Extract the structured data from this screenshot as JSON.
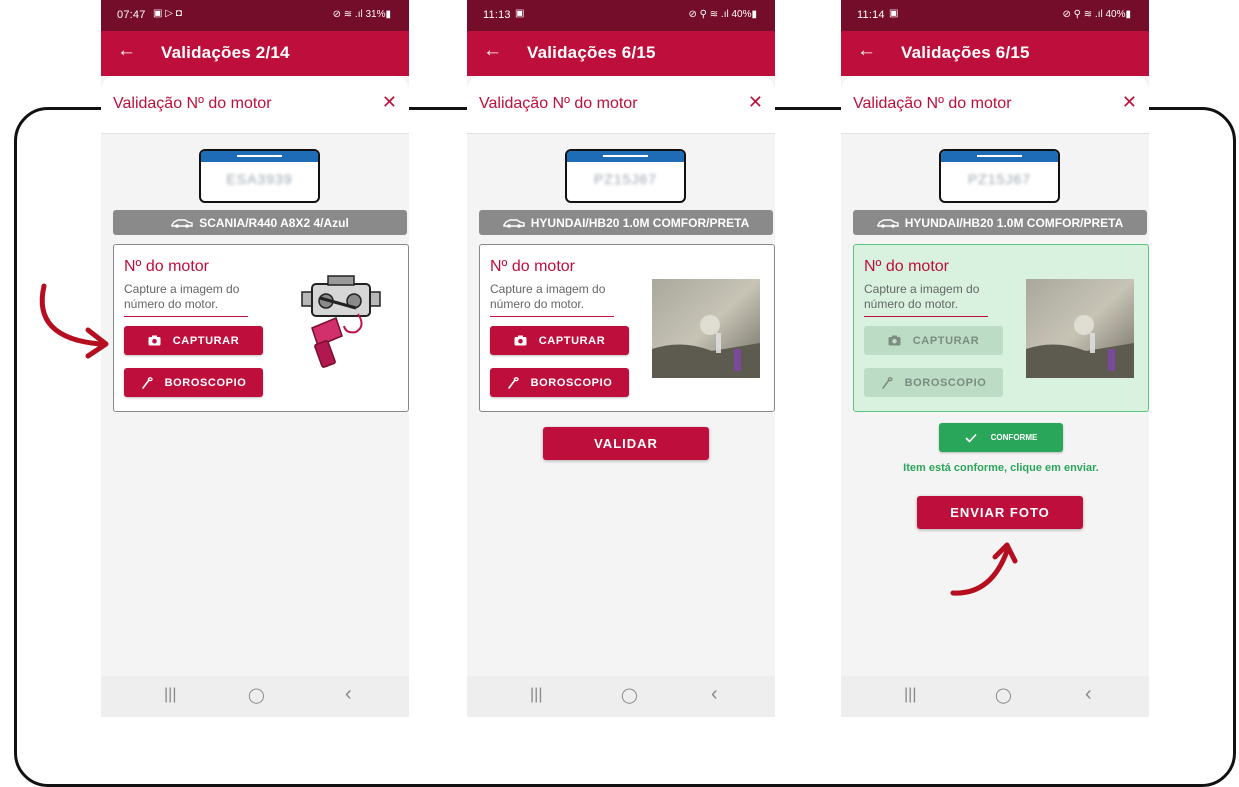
{
  "phones": [
    {
      "status": {
        "time": "07:47",
        "icons": "▣ ▷ ◘",
        "right": "⊘ ≋ .ıl 31%▮"
      },
      "appbar": {
        "back": "←",
        "title": "Validações 2/14"
      },
      "sheet": {
        "title": "Validação Nº do motor",
        "close": "✕"
      },
      "plate": "ESA3939",
      "vehicle": "SCANIA/R440 A8X2 4/Azul",
      "card": {
        "title": "Nº do motor",
        "description": "Capture a imagem do número do motor.",
        "capture_label": "CAPTURAR",
        "boroscope_label": "BOROSCOPIO"
      }
    },
    {
      "status": {
        "time": "11:13",
        "icons": "▣",
        "right": "⊘ ⚲ ≋ .ıl 40%▮"
      },
      "appbar": {
        "back": "←",
        "title": "Validações 6/15"
      },
      "sheet": {
        "title": "Validação Nº do motor",
        "close": "✕"
      },
      "plate": "PZ15J67",
      "vehicle": "HYUNDAI/HB20 1.0M COMFOR/PRETA",
      "card": {
        "title": "Nº do motor",
        "description": "Capture a imagem do número do motor.",
        "capture_label": "CAPTURAR",
        "boroscope_label": "BOROSCOPIO"
      },
      "validate_label": "VALIDAR"
    },
    {
      "status": {
        "time": "11:14",
        "icons": "▣",
        "right": "⊘ ⚲ ≋ .ıl 40%▮"
      },
      "appbar": {
        "back": "←",
        "title": "Validações 6/15"
      },
      "sheet": {
        "title": "Validação Nº do motor",
        "close": "✕"
      },
      "plate": "PZ15J67",
      "vehicle": "HYUNDAI/HB20 1.0M COMFOR/PRETA",
      "card": {
        "title": "Nº do motor",
        "description": "Capture a imagem do número do motor.",
        "capture_label": "CAPTURAR",
        "boroscope_label": "BOROSCOPIO"
      },
      "conform_label": "CONFORME",
      "conform_message": "Item está conforme, clique em enviar.",
      "send_label": "ENVIAR FOTO"
    }
  ],
  "navbar": {
    "recent": "|||",
    "home": "◯",
    "back": "‹"
  },
  "colors": {
    "primary": "#be0f3c",
    "status_bar": "#740d2a",
    "success": "#2aa65a",
    "success_bg": "#d8f2df",
    "vehicle_bar": "#8a8a8a",
    "plate_blue": "#1e6cb6",
    "arrow": "#b50f1f"
  },
  "icons": {
    "back": "arrow-left-icon",
    "close": "close-icon",
    "car": "car-icon",
    "camera": "camera-icon",
    "probe": "boroscope-probe-icon",
    "check": "check-icon",
    "engine": "engine-boroscope-illustration",
    "arrows": "curved-arrow-icon"
  }
}
